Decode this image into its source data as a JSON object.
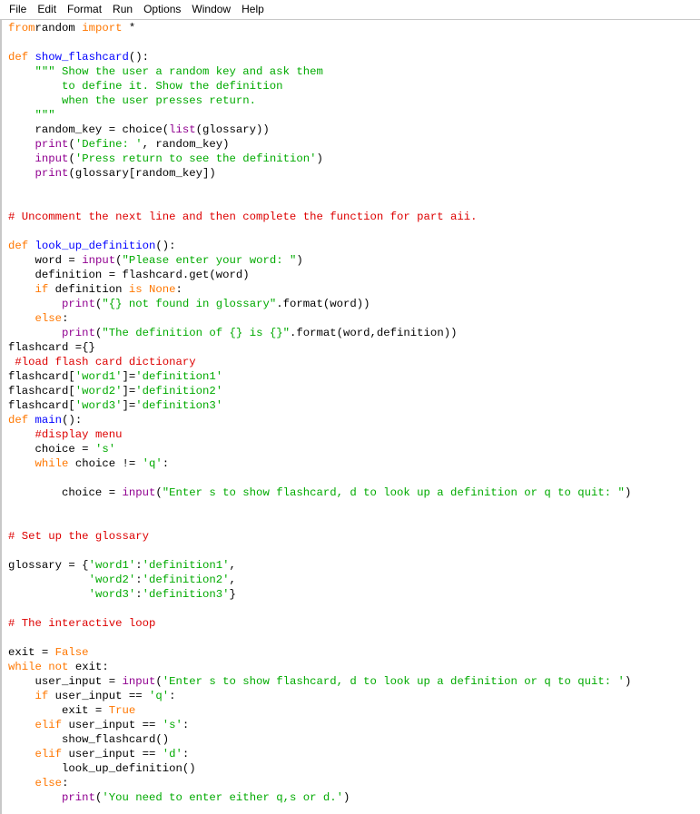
{
  "menu": [
    "File",
    "Edit",
    "Format",
    "Run",
    "Options",
    "Window",
    "Help"
  ],
  "colors": {
    "keyword": "#ff7700",
    "builtin": "#900090",
    "string": "#00aa00",
    "comment": "#dd0000",
    "definition": "#0000ff"
  },
  "code": [
    [
      [
        "kw",
        "from"
      ],
      [
        "",
        "random "
      ],
      [
        "kw",
        "import"
      ],
      [
        "",
        " *"
      ]
    ],
    [],
    [
      [
        "kw",
        "def"
      ],
      [
        "",
        " "
      ],
      [
        "df",
        "show_flashcard"
      ],
      [
        "",
        "():"
      ]
    ],
    [
      [
        "",
        "    "
      ],
      [
        "st",
        "\"\"\" Show the user a random key and ask them"
      ]
    ],
    [
      [
        "st",
        "        to define it. Show the definition"
      ]
    ],
    [
      [
        "st",
        "        when the user presses return."
      ]
    ],
    [
      [
        "st",
        "    \"\"\""
      ]
    ],
    [
      [
        "",
        "    random_key = choice("
      ],
      [
        "bi",
        "list"
      ],
      [
        "",
        "(glossary))"
      ]
    ],
    [
      [
        "",
        "    "
      ],
      [
        "bi",
        "print"
      ],
      [
        "",
        "("
      ],
      [
        "st",
        "'Define: '"
      ],
      [
        "",
        ", random_key)"
      ]
    ],
    [
      [
        "",
        "    "
      ],
      [
        "bi",
        "input"
      ],
      [
        "",
        "("
      ],
      [
        "st",
        "'Press return to see the definition'"
      ],
      [
        "",
        ")"
      ]
    ],
    [
      [
        "",
        "    "
      ],
      [
        "bi",
        "print"
      ],
      [
        "",
        "(glossary[random_key])"
      ]
    ],
    [],
    [],
    [
      [
        "cm",
        "# Uncomment the next line and then complete the function for part aii."
      ]
    ],
    [],
    [
      [
        "kw",
        "def"
      ],
      [
        "",
        " "
      ],
      [
        "df",
        "look_up_definition"
      ],
      [
        "",
        "():"
      ]
    ],
    [
      [
        "",
        "    word = "
      ],
      [
        "bi",
        "input"
      ],
      [
        "",
        "("
      ],
      [
        "st",
        "\"Please enter your word: \""
      ],
      [
        "",
        ")"
      ]
    ],
    [
      [
        "",
        "    definition = flashcard.get(word)"
      ]
    ],
    [
      [
        "",
        "    "
      ],
      [
        "kw",
        "if"
      ],
      [
        "",
        " definition "
      ],
      [
        "kw",
        "is"
      ],
      [
        "",
        " "
      ],
      [
        "kw",
        "None"
      ],
      [
        "",
        ":"
      ]
    ],
    [
      [
        "",
        "        "
      ],
      [
        "bi",
        "print"
      ],
      [
        "",
        "("
      ],
      [
        "st",
        "\"{} not found in glossary\""
      ],
      [
        "",
        ".format(word))"
      ]
    ],
    [
      [
        "",
        "    "
      ],
      [
        "kw",
        "else"
      ],
      [
        "",
        ":"
      ]
    ],
    [
      [
        "",
        "        "
      ],
      [
        "bi",
        "print"
      ],
      [
        "",
        "("
      ],
      [
        "st",
        "\"The definition of {} is {}\""
      ],
      [
        "",
        ".format(word,definition))"
      ]
    ],
    [
      [
        "",
        "flashcard ={}"
      ]
    ],
    [
      [
        "cm",
        " #load flash card dictionary"
      ]
    ],
    [
      [
        "",
        "flashcard["
      ],
      [
        "st",
        "'word1'"
      ],
      [
        "",
        "]="
      ],
      [
        "st",
        "'definition1'"
      ]
    ],
    [
      [
        "",
        "flashcard["
      ],
      [
        "st",
        "'word2'"
      ],
      [
        "",
        "]="
      ],
      [
        "st",
        "'definition2'"
      ]
    ],
    [
      [
        "",
        "flashcard["
      ],
      [
        "st",
        "'word3'"
      ],
      [
        "",
        "]="
      ],
      [
        "st",
        "'definition3'"
      ]
    ],
    [
      [
        "kw",
        "def"
      ],
      [
        "",
        " "
      ],
      [
        "df",
        "main"
      ],
      [
        "",
        "():"
      ]
    ],
    [
      [
        "",
        "    "
      ],
      [
        "cm",
        "#display menu"
      ]
    ],
    [
      [
        "",
        "    choice = "
      ],
      [
        "st",
        "'s'"
      ]
    ],
    [
      [
        "",
        "    "
      ],
      [
        "kw",
        "while"
      ],
      [
        "",
        " choice != "
      ],
      [
        "st",
        "'q'"
      ],
      [
        "",
        ":"
      ]
    ],
    [],
    [
      [
        "",
        "        choice = "
      ],
      [
        "bi",
        "input"
      ],
      [
        "",
        "("
      ],
      [
        "st",
        "\"Enter s to show flashcard, d to look up a definition or q to quit: \""
      ],
      [
        "",
        ")"
      ]
    ],
    [],
    [],
    [
      [
        "cm",
        "# Set up the glossary"
      ]
    ],
    [],
    [
      [
        "",
        "glossary = {"
      ],
      [
        "st",
        "'word1'"
      ],
      [
        "",
        ":"
      ],
      [
        "st",
        "'definition1'"
      ],
      [
        "",
        ","
      ]
    ],
    [
      [
        "",
        "            "
      ],
      [
        "st",
        "'word2'"
      ],
      [
        "",
        ":"
      ],
      [
        "st",
        "'definition2'"
      ],
      [
        "",
        ","
      ]
    ],
    [
      [
        "",
        "            "
      ],
      [
        "st",
        "'word3'"
      ],
      [
        "",
        ":"
      ],
      [
        "st",
        "'definition3'"
      ],
      [
        "",
        "}"
      ]
    ],
    [],
    [
      [
        "cm",
        "# The interactive loop"
      ]
    ],
    [],
    [
      [
        "",
        "exit = "
      ],
      [
        "kw",
        "False"
      ]
    ],
    [
      [
        "kw",
        "while"
      ],
      [
        "",
        " "
      ],
      [
        "kw",
        "not"
      ],
      [
        "",
        " exit:"
      ]
    ],
    [
      [
        "",
        "    user_input = "
      ],
      [
        "bi",
        "input"
      ],
      [
        "",
        "("
      ],
      [
        "st",
        "'Enter s to show flashcard, d to look up a definition or q to quit: '"
      ],
      [
        "",
        ")"
      ]
    ],
    [
      [
        "",
        "    "
      ],
      [
        "kw",
        "if"
      ],
      [
        "",
        " user_input == "
      ],
      [
        "st",
        "'q'"
      ],
      [
        "",
        ":"
      ]
    ],
    [
      [
        "",
        "        exit = "
      ],
      [
        "kw",
        "True"
      ]
    ],
    [
      [
        "",
        "    "
      ],
      [
        "kw",
        "elif"
      ],
      [
        "",
        " user_input == "
      ],
      [
        "st",
        "'s'"
      ],
      [
        "",
        ":"
      ]
    ],
    [
      [
        "",
        "        show_flashcard()"
      ]
    ],
    [
      [
        "",
        "    "
      ],
      [
        "kw",
        "elif"
      ],
      [
        "",
        " user_input == "
      ],
      [
        "st",
        "'d'"
      ],
      [
        "",
        ":"
      ]
    ],
    [
      [
        "",
        "        look_up_definition()"
      ]
    ],
    [
      [
        "",
        "    "
      ],
      [
        "kw",
        "else"
      ],
      [
        "",
        ":"
      ]
    ],
    [
      [
        "",
        "        "
      ],
      [
        "bi",
        "print"
      ],
      [
        "",
        "("
      ],
      [
        "st",
        "'You need to enter either q,s or d.'"
      ],
      [
        "",
        ")"
      ]
    ]
  ]
}
